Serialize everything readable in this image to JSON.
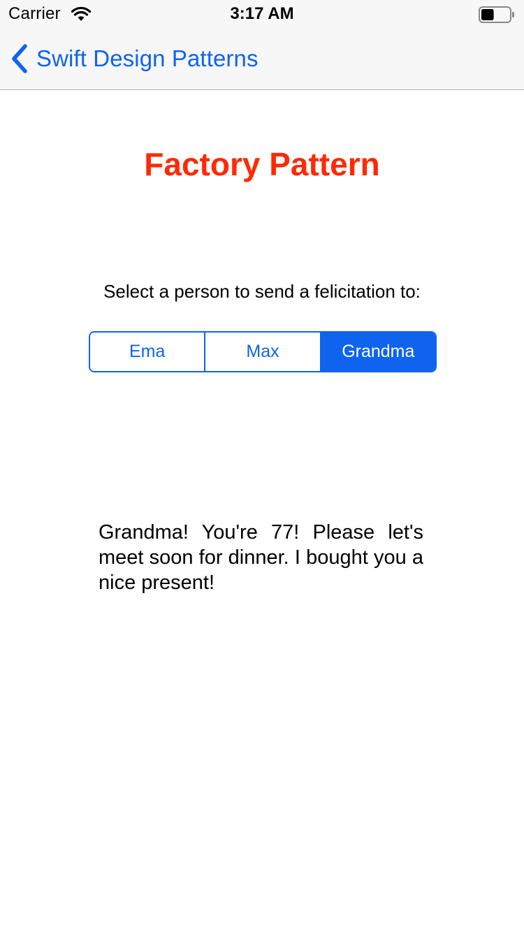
{
  "status_bar": {
    "carrier": "Carrier",
    "time": "3:17 AM",
    "wifi_icon": "wifi-icon",
    "battery_icon": "battery-icon",
    "battery_level": 0.45
  },
  "nav_bar": {
    "back_label": "Swift Design Patterns",
    "back_icon": "chevron-left-icon",
    "tint_color": "#0f63ef"
  },
  "main": {
    "title": "Factory Pattern",
    "title_color": "#ff2a05",
    "prompt": "Select a person to send a felicitation to:",
    "segments": [
      {
        "label": "Ema",
        "selected": false
      },
      {
        "label": "Max",
        "selected": false
      },
      {
        "label": "Grandma",
        "selected": true
      }
    ],
    "message": "Grandma! You're 77! Please let's meet soon for dinner. I bought you a nice present!"
  }
}
